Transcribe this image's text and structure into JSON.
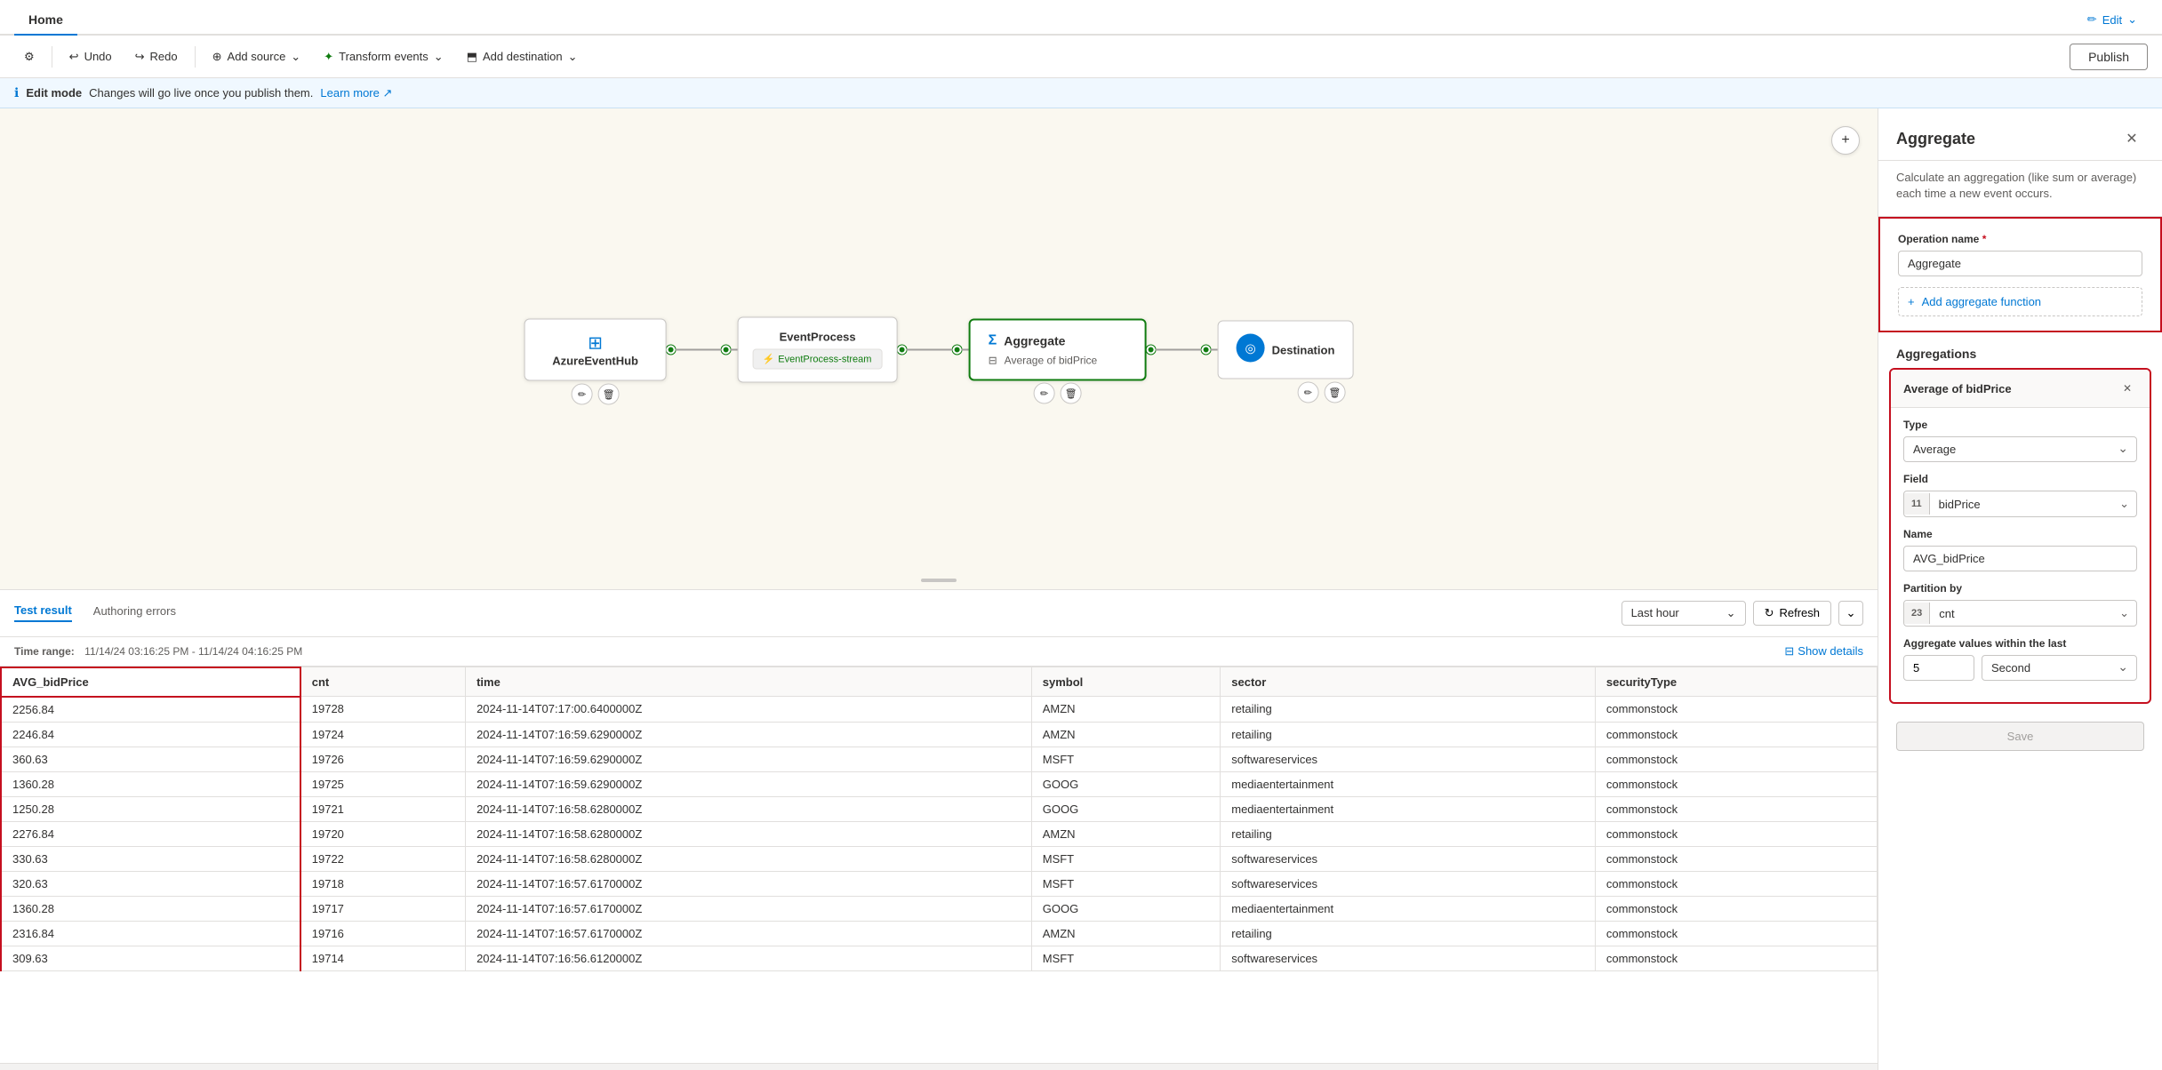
{
  "app": {
    "tab": "Home"
  },
  "toolbar": {
    "undo_label": "Undo",
    "redo_label": "Redo",
    "add_source_label": "Add source",
    "transform_events_label": "Transform events",
    "add_destination_label": "Add destination",
    "publish_label": "Publish",
    "settings_icon": "⚙"
  },
  "info_bar": {
    "mode_label": "Edit mode",
    "message": "Changes will go live once you publish them.",
    "learn_more": "Learn more"
  },
  "pipeline": {
    "nodes": [
      {
        "id": "azure-event-hub",
        "title": "AzureEventHub",
        "icon": "⊞"
      },
      {
        "id": "event-process",
        "title": "EventProcess",
        "subtitle": "EventProcess-stream"
      },
      {
        "id": "aggregate",
        "title": "Aggregate",
        "subtitle": "Average of bidPrice"
      },
      {
        "id": "destination",
        "title": "Destination"
      }
    ]
  },
  "canvas": {
    "plus_btn": "+"
  },
  "test_panel": {
    "tabs": [
      "Test result",
      "Authoring errors"
    ],
    "active_tab": "Test result",
    "time_range_label": "Time range:",
    "time_range_value": "11/14/24 03:16:25 PM - 11/14/24 04:16:25 PM",
    "last_hour_label": "Last hour",
    "refresh_label": "Refresh",
    "show_details_label": "Show details",
    "columns": [
      "AVG_bidPrice",
      "cnt",
      "time",
      "symbol",
      "sector",
      "securityType"
    ],
    "rows": [
      [
        "2256.84",
        "19728",
        "2024-11-14T07:17:00.6400000Z",
        "AMZN",
        "retailing",
        "commonstock"
      ],
      [
        "2246.84",
        "19724",
        "2024-11-14T07:16:59.6290000Z",
        "AMZN",
        "retailing",
        "commonstock"
      ],
      [
        "360.63",
        "19726",
        "2024-11-14T07:16:59.6290000Z",
        "MSFT",
        "softwareservices",
        "commonstock"
      ],
      [
        "1360.28",
        "19725",
        "2024-11-14T07:16:59.6290000Z",
        "GOOG",
        "mediaentertainment",
        "commonstock"
      ],
      [
        "1250.28",
        "19721",
        "2024-11-14T07:16:58.6280000Z",
        "GOOG",
        "mediaentertainment",
        "commonstock"
      ],
      [
        "2276.84",
        "19720",
        "2024-11-14T07:16:58.6280000Z",
        "AMZN",
        "retailing",
        "commonstock"
      ],
      [
        "330.63",
        "19722",
        "2024-11-14T07:16:58.6280000Z",
        "MSFT",
        "softwareservices",
        "commonstock"
      ],
      [
        "320.63",
        "19718",
        "2024-11-14T07:16:57.6170000Z",
        "MSFT",
        "softwareservices",
        "commonstock"
      ],
      [
        "1360.28",
        "19717",
        "2024-11-14T07:16:57.6170000Z",
        "GOOG",
        "mediaentertainment",
        "commonstock"
      ],
      [
        "2316.84",
        "19716",
        "2024-11-14T07:16:57.6170000Z",
        "AMZN",
        "retailing",
        "commonstock"
      ],
      [
        "309.63",
        "19714",
        "2024-11-14T07:16:56.6120000Z",
        "MSFT",
        "softwareservices",
        "commonstock"
      ]
    ]
  },
  "right_panel": {
    "title": "Aggregate",
    "description": "Calculate an aggregation (like sum or average) each time a new event occurs.",
    "operation_name_label": "Operation name",
    "operation_name_required": "*",
    "operation_name_value": "Aggregate",
    "add_aggregate_function_label": "Add aggregate function",
    "aggregations_title": "Aggregations",
    "agg_card": {
      "title": "Average of bidPrice",
      "type_label": "Type",
      "type_value": "Average",
      "field_label": "Field",
      "field_icon": "11",
      "field_value": "bidPrice",
      "name_label": "Name",
      "name_value": "AVG_bidPrice",
      "partition_by_label": "Partition by",
      "partition_icon": "23",
      "partition_value": "cnt",
      "within_label": "Aggregate values within the last",
      "within_num": "5",
      "within_unit": "Second"
    },
    "save_label": "Save"
  }
}
